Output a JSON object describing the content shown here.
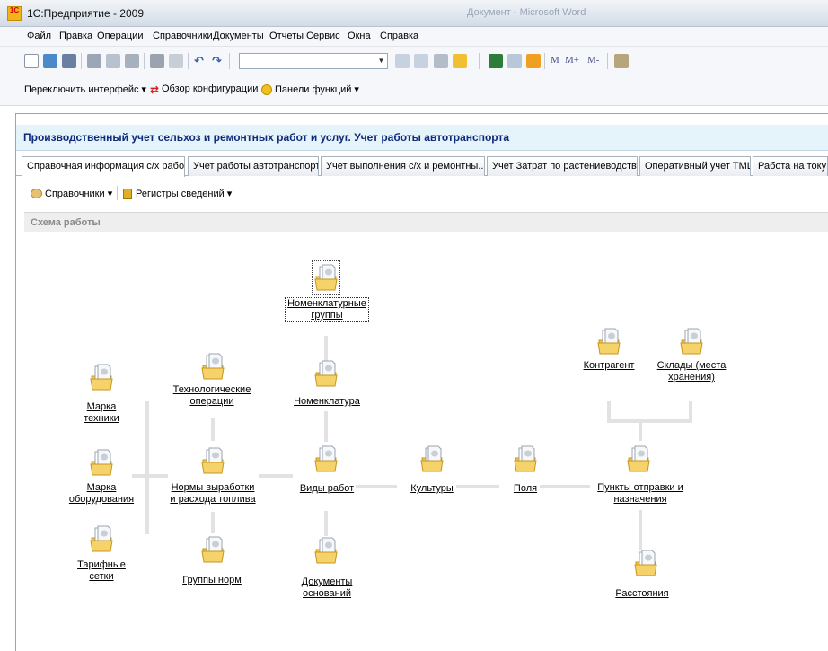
{
  "window": {
    "title": "1С:Предприятие - 2009",
    "background_title": "Документ - Microsoft Word",
    "logo_text": "1С"
  },
  "menu": [
    "Файл",
    "Правка",
    "Операции",
    "Справочники",
    "Документы",
    "Отчеты",
    "Сервис",
    "Окна",
    "Справка"
  ],
  "toolbar": {
    "memory_buttons": [
      "M",
      "M+",
      "M-"
    ]
  },
  "toolbar2": {
    "switch_interface": "Переключить интерфейс ▾",
    "config_overview": "Обзор конфигурации",
    "function_panels": "Панели функций ▾"
  },
  "banner": {
    "title": "Производственный учет сельхоз и ремонтных работ и услуг. Учет работы автотранспорта"
  },
  "tabs": [
    "Справочная информация с/х работ",
    "Учет работы автотранспорта",
    "Учет выполнения с/х и ремонтны...",
    "Учет Затрат по растениеводству",
    "Оперативный учет ТМЦ",
    "Работа на току"
  ],
  "subtoolbar": {
    "catalogs": "Справочники ▾",
    "registers": "Регистры сведений ▾"
  },
  "scheme": {
    "title": "Схема работы",
    "nodes": {
      "nomenclature_groups": [
        "Номенклатурные",
        "группы"
      ],
      "nomenclature": "Номенклатура",
      "tech_operations": [
        "Технологические",
        "операции"
      ],
      "machine_brand": [
        "Марка",
        "техники"
      ],
      "equipment_brand": [
        "Марка",
        "оборудования"
      ],
      "tariff_grids": [
        "Тарифные",
        "сетки"
      ],
      "norms": [
        "Нормы выработки",
        "и расхода топлива"
      ],
      "norm_groups": "Группы норм",
      "work_types": "Виды работ",
      "base_documents": [
        "Документы",
        "оснований"
      ],
      "crops": "Культуры",
      "fields": "Поля",
      "points": [
        "Пункты отправки и",
        "назначения"
      ],
      "counterparty": "Контрагент",
      "warehouses": [
        "Склады (места",
        "хранения)"
      ],
      "distances": "Расстояния"
    }
  }
}
